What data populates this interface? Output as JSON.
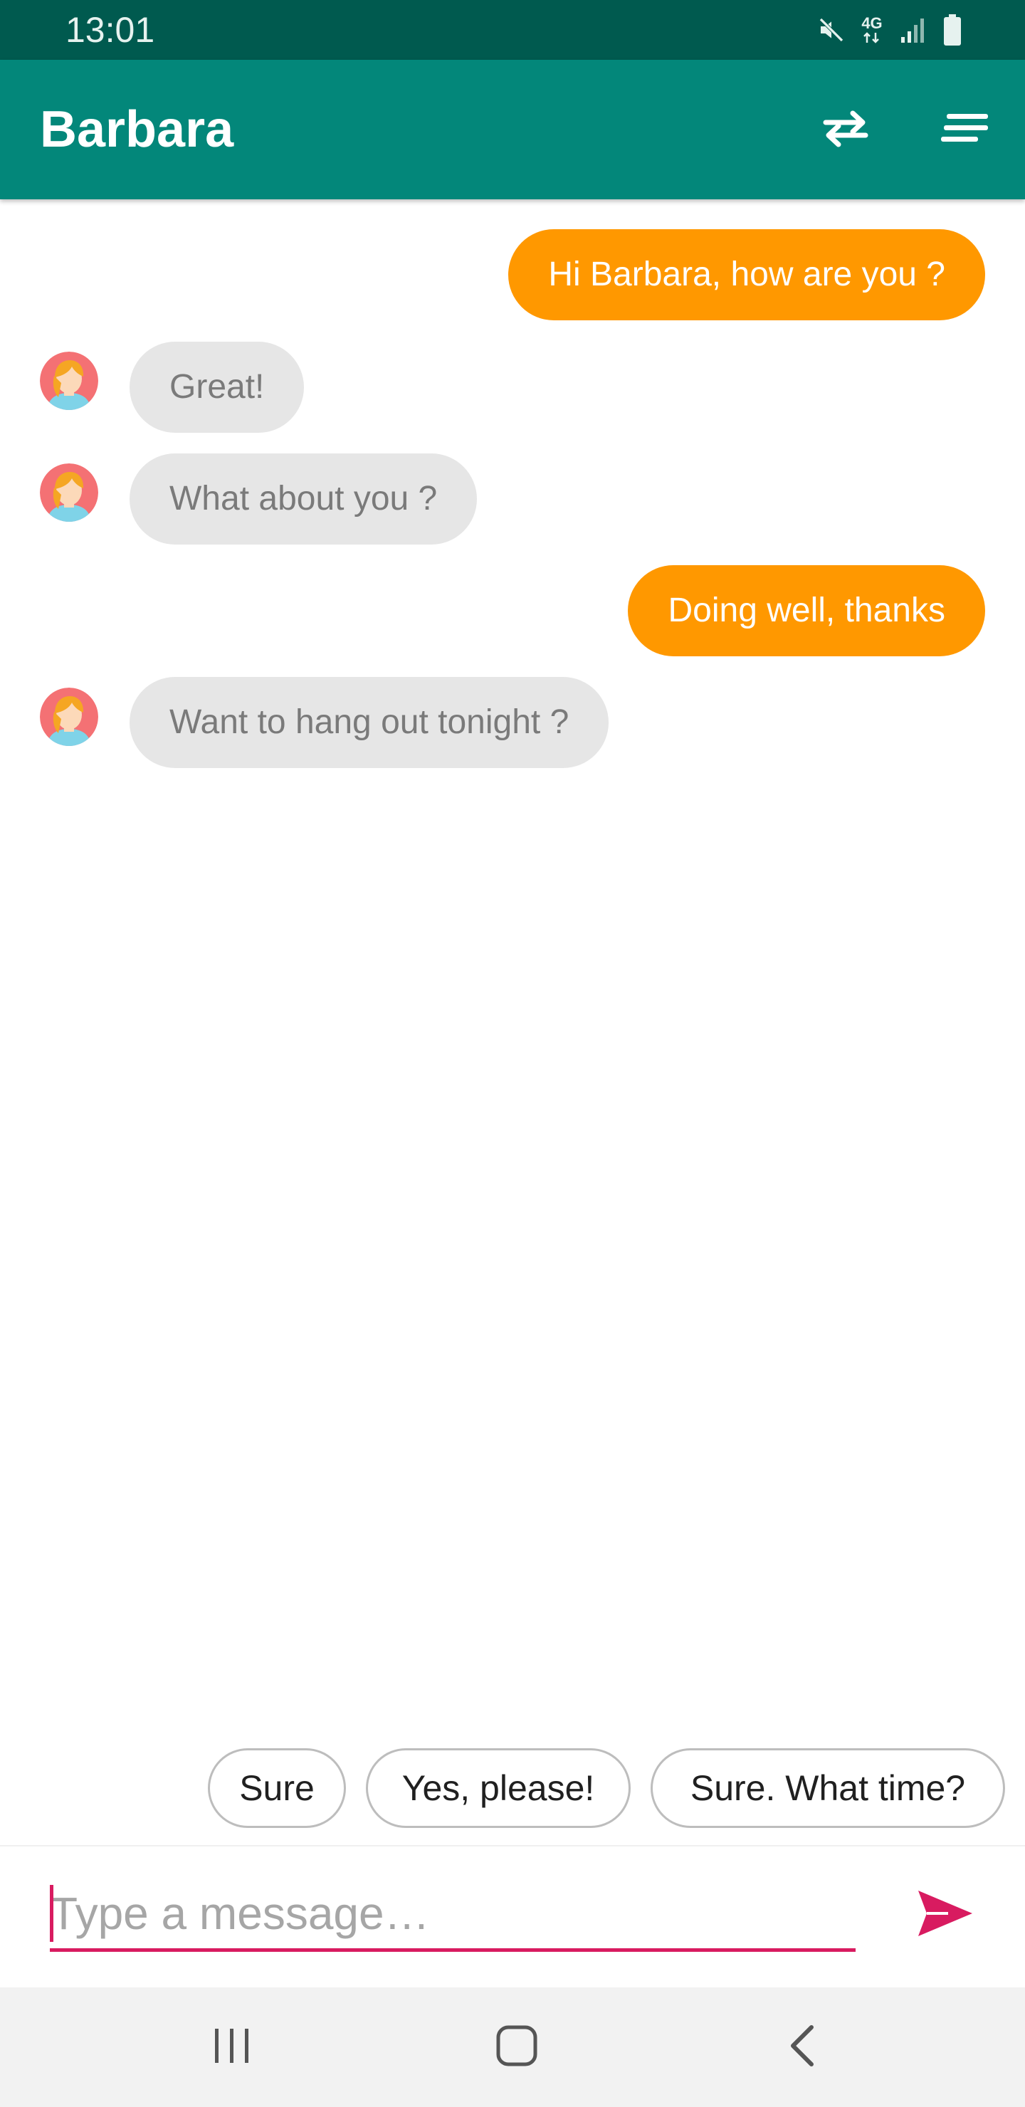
{
  "status_bar": {
    "time": "13:01",
    "network_label": "4G",
    "icons": [
      "mute-icon",
      "network-4g-icon",
      "signal-icon",
      "battery-icon"
    ]
  },
  "app_bar": {
    "title": "Barbara",
    "actions": [
      "swap-icon",
      "menu-icon"
    ]
  },
  "conversation": {
    "messages": [
      {
        "direction": "outgoing",
        "text": "Hi Barbara, how are you ?"
      },
      {
        "direction": "incoming",
        "text": "Great!"
      },
      {
        "direction": "incoming",
        "text": "What about you ?"
      },
      {
        "direction": "outgoing",
        "text": "Doing well, thanks"
      },
      {
        "direction": "incoming",
        "text": "Want to hang out tonight ?"
      }
    ]
  },
  "smart_replies": [
    "Sure",
    "Yes, please!",
    "Sure. What time?"
  ],
  "composer": {
    "value": "",
    "placeholder": "Type a message…"
  },
  "nav_bar": {
    "buttons": [
      "recent-apps-icon",
      "home-icon",
      "back-icon"
    ]
  },
  "colors": {
    "status_bar": "#005a4f",
    "app_bar": "#03877a",
    "outgoing_bubble": "#ff9800",
    "incoming_bubble": "#e6e6e6",
    "accent": "#d81b60"
  }
}
